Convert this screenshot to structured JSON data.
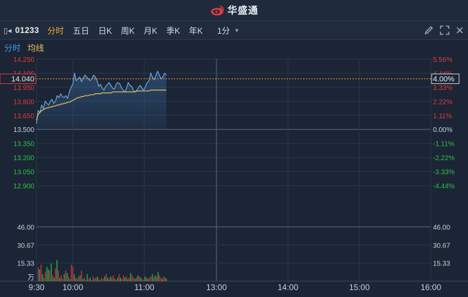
{
  "app": {
    "brand": "华盛通"
  },
  "toolbar": {
    "stock_code": "01233",
    "tabs": [
      "分时",
      "五日",
      "日K",
      "周K",
      "月K",
      "季K",
      "年K"
    ],
    "active_tab": "分时",
    "interval": "1分"
  },
  "legend": {
    "line_label": "分时",
    "avg_label": "均线"
  },
  "chart_data": {
    "type": "line",
    "prev_close": 13.5,
    "current_price_label": "14.040",
    "current_pct_label": "4.00%",
    "price_ticks": [
      "14.250",
      "14.100",
      "13.950",
      "13.800",
      "13.650",
      "13.500",
      "13.350",
      "13.200",
      "13.050",
      "12.900"
    ],
    "pct_ticks": [
      "5.56%",
      "4.44%",
      "3.33%",
      "2.22%",
      "1.11%",
      "0.00%",
      "-1.11%",
      "-2.22%",
      "-3.33%",
      "-4.44%"
    ],
    "volume_ticks": [
      "46.00",
      "30.67",
      "15.33"
    ],
    "volume_unit": "万",
    "time_ticks": [
      "9:30",
      "10:00",
      "11:00",
      "13:00",
      "14:00",
      "15:00",
      "16:00"
    ],
    "price_series": [
      13.56,
      13.7,
      13.68,
      13.76,
      13.72,
      13.8,
      13.78,
      13.76,
      13.8,
      13.82,
      13.78,
      13.8,
      13.86,
      13.84,
      13.88,
      13.85,
      13.84,
      13.86,
      13.83,
      13.9,
      13.95,
      13.98,
      14.1,
      14.02,
      14.04,
      14.06,
      14.01,
      14.05,
      14.08,
      14.06,
      14.04,
      14.02,
      14.04,
      14.08,
      14.06,
      14.02,
      13.96,
      13.98,
      13.94,
      13.92,
      13.96,
      13.98,
      14.0,
      13.97,
      13.94,
      13.93,
      13.98,
      14.0,
      13.99,
      13.95,
      13.92,
      13.9,
      13.94,
      14.0,
      13.97,
      13.96,
      13.92,
      13.9,
      13.92,
      13.95,
      13.97,
      13.94,
      13.92,
      13.96,
      14.0,
      14.02,
      14.1,
      14.06,
      14.03,
      14.08,
      14.12,
      14.08,
      14.04,
      14.06,
      14.1,
      14.08
    ],
    "avg_series": [
      13.6,
      13.66,
      13.68,
      13.7,
      13.71,
      13.72,
      13.73,
      13.73,
      13.74,
      13.74,
      13.75,
      13.75,
      13.76,
      13.76,
      13.77,
      13.77,
      13.78,
      13.78,
      13.79,
      13.79,
      13.8,
      13.81,
      13.82,
      13.83,
      13.84,
      13.84,
      13.85,
      13.85,
      13.86,
      13.86,
      13.86,
      13.87,
      13.87,
      13.87,
      13.88,
      13.88,
      13.88,
      13.88,
      13.89,
      13.89,
      13.89,
      13.89,
      13.89,
      13.89,
      13.9,
      13.9,
      13.9,
      13.9,
      13.9,
      13.9,
      13.9,
      13.9,
      13.9,
      13.9,
      13.9,
      13.9,
      13.9,
      13.9,
      13.91,
      13.91,
      13.91,
      13.91,
      13.91,
      13.91,
      13.91,
      13.91,
      13.92,
      13.92,
      13.92,
      13.92,
      13.92,
      13.92,
      13.92,
      13.92,
      13.92,
      13.92
    ],
    "volume_series": [
      12,
      10,
      14,
      6,
      3,
      8,
      12,
      10,
      9,
      15,
      5,
      3,
      11,
      18,
      9,
      3,
      5,
      2,
      6,
      9,
      7,
      4,
      2,
      14,
      12,
      6,
      3,
      2,
      4,
      5,
      9,
      2,
      3,
      1,
      6,
      2,
      3,
      1,
      4,
      2,
      3,
      4,
      2,
      1,
      3,
      2,
      4,
      6,
      3,
      2,
      4,
      3,
      5,
      2,
      1,
      3,
      6,
      3,
      2,
      5,
      3,
      4,
      2,
      3,
      7,
      5,
      3,
      2,
      3,
      5,
      4,
      3,
      2,
      1,
      4,
      3,
      2,
      3,
      4,
      6,
      3,
      5,
      4,
      8,
      5,
      3,
      2,
      4,
      3,
      2
    ],
    "volume_colors": [
      "red",
      "green",
      "red",
      "green",
      "red",
      "red",
      "green",
      "green",
      "red",
      "green",
      "red",
      "green",
      "red",
      "green",
      "red",
      "green",
      "red",
      "red",
      "green",
      "red",
      "green",
      "red",
      "green",
      "red",
      "red",
      "green",
      "red",
      "green",
      "red",
      "green",
      "red",
      "green",
      "red",
      "red",
      "green",
      "red",
      "green",
      "red",
      "red",
      "green",
      "red",
      "green",
      "red",
      "green",
      "red",
      "red",
      "green",
      "red",
      "green",
      "red",
      "green",
      "red",
      "red",
      "green",
      "red",
      "green",
      "red",
      "green",
      "red",
      "red",
      "green",
      "red",
      "green",
      "red",
      "green",
      "red",
      "red",
      "green",
      "red",
      "green",
      "red",
      "green",
      "red",
      "red",
      "green",
      "red",
      "green",
      "red",
      "red",
      "green",
      "red",
      "green",
      "red",
      "green",
      "red",
      "red",
      "green",
      "red",
      "green",
      "red"
    ],
    "colors": {
      "up": "#e0393e",
      "down": "#2fbf4a",
      "line": "#7ab8f0",
      "avg": "#e8c25a",
      "neutral": "#c9d1dc"
    }
  }
}
